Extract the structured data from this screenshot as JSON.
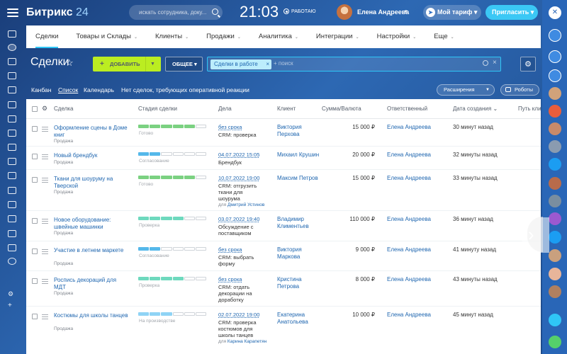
{
  "app": {
    "logo_name": "Битрикс",
    "logo_num": "24"
  },
  "header": {
    "search_placeholder": "искать сотрудника, доку...",
    "clock": "21:03",
    "work_status": "РАБОТАЮ",
    "user_name": "Елена Андреева",
    "tariff_label": "Мой тариф",
    "invite_label": "Пригласить"
  },
  "nav": [
    "Сделки",
    "Товары и Склады",
    "Клиенты",
    "Продажи",
    "Аналитика",
    "Интеграции",
    "Настройки",
    "Еще"
  ],
  "toolbar": {
    "title": "Сделки",
    "add_label": "ДОБАВИТЬ",
    "general_label": "ОБЩЕЕ",
    "filter_chip": "Сделки в работе",
    "filter_placeholder": "+ поиск"
  },
  "views": {
    "kanban": "Канбан",
    "list": "Список",
    "calendar": "Календарь",
    "no_deals": "Нет сделок, требующих оперативной реакции",
    "extensions": "Расширения",
    "robots": "Роботы"
  },
  "columns": {
    "deal": "Сделка",
    "stage": "Стадия сделки",
    "tasks": "Дела",
    "client": "Клиент",
    "sum": "Сумма/Валюта",
    "responsible": "Ответственный",
    "created": "Дата создания",
    "path": "Путь кли"
  },
  "rows": [
    {
      "name": "Оформление сцены в Доме книг",
      "type": "Продажа",
      "stage": "Готово",
      "stage_fill": 0.83,
      "stage_color": "#7bd181",
      "date": "без срока",
      "task": "CRM: проверка",
      "for": "",
      "client": "Виктория Перхова",
      "sum": "15 000 ₽",
      "resp": "Елена Андреева",
      "created": "30 минут назад"
    },
    {
      "name": "Новый брендбук",
      "type": "Продажа",
      "stage": "Согласование",
      "stage_fill": 0.33,
      "stage_color": "#55b8ea",
      "date": "04.07.2022 15:05",
      "task": "Брендбук",
      "for": "",
      "client": "Михаил Крушин",
      "sum": "20 000 ₽",
      "resp": "Елена Андреева",
      "created": "32 минуты назад"
    },
    {
      "name": "Ткани для шоуруму на Тверской",
      "type": "Продажа",
      "stage": "Готово",
      "stage_fill": 0.83,
      "stage_color": "#7bd181",
      "date": "10.07.2022 19:00",
      "task": "CRM: отгрузить ткани для шоурума",
      "for": "Дмитрий Устинов",
      "client": "Максим Петров",
      "sum": "15 000 ₽",
      "resp": "Елена Андреева",
      "created": "33 минуты назад"
    },
    {
      "name": "Новое оборудование: швейные машинки",
      "type": "Продажа",
      "stage": "Проверка",
      "stage_fill": 0.66,
      "stage_color": "#6ed9be",
      "date": "03.07.2022 19:40",
      "task": "Обсуждение с поставщиком",
      "for": "",
      "client": "Владимир Климентьев",
      "sum": "110 000 ₽",
      "resp": "Елена Андреева",
      "created": "36 минут назад"
    },
    {
      "name": "Участие в летнем маркете",
      "type": "Продажа",
      "stage": "Согласование",
      "stage_fill": 0.33,
      "stage_color": "#55b8ea",
      "date": "без срока",
      "task": "CRM: выбрать форму",
      "for": "",
      "client": "Виктория Маркова",
      "sum": "9 000 ₽",
      "resp": "Елена Андреева",
      "created": "41 минуту назад"
    },
    {
      "name": "Роспись декораций для МДТ",
      "type": "Продажа",
      "stage": "Проверка",
      "stage_fill": 0.66,
      "stage_color": "#6ed9be",
      "date": "без срока",
      "task": "CRM: отдать декорации на доработку",
      "for": "",
      "client": "Кристина Петрова",
      "sum": "8 000 ₽",
      "resp": "Елена Андреева",
      "created": "43 минуты назад"
    },
    {
      "name": "Костюмы для школы танцев",
      "type": "Продажа",
      "stage": "На производстве",
      "stage_fill": 0.5,
      "stage_color": "#8fd3f5",
      "date": "02.07.2022 19:00",
      "task": "CRM: проверка костюмов для школы танцев",
      "for": "Карина Карапетян",
      "client": "Екатерина Анатольева",
      "sum": "10 000 ₽",
      "resp": "Елена Андреева",
      "created": "45 минут назад"
    }
  ],
  "for_prefix": "для",
  "colors": {
    "accent": "#2fc6f6",
    "add_button": "#bbed21",
    "link": "#2067b0"
  }
}
